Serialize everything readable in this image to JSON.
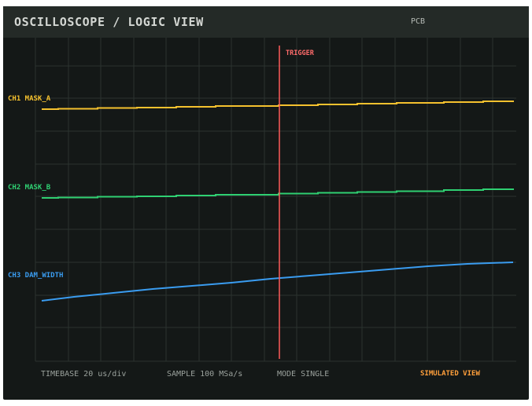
{
  "header": {
    "title": "OSCILLOSCOPE / LOGIC VIEW",
    "board": "PCB"
  },
  "trigger": {
    "label": "TRIGGER",
    "color": "#ff5a5a"
  },
  "channels": [
    {
      "label": "CH1 MASK_A",
      "color": "#f5c12e"
    },
    {
      "label": "CH2 MASK_B",
      "color": "#2fd072"
    },
    {
      "label": "CH3 DAM_WIDTH",
      "color": "#3a9cf0"
    }
  ],
  "status": {
    "timebase": "TIMEBASE  20 us/div",
    "sample": "SAMPLE 100 MSa/s",
    "mode": "MODE SINGLE",
    "view": "SIMULATED VIEW"
  },
  "colors": {
    "background": "#141817",
    "header": "#242a27",
    "grid": "#2b322f",
    "status_text": "#9aa19c",
    "accent": "#ff9f3b"
  }
}
